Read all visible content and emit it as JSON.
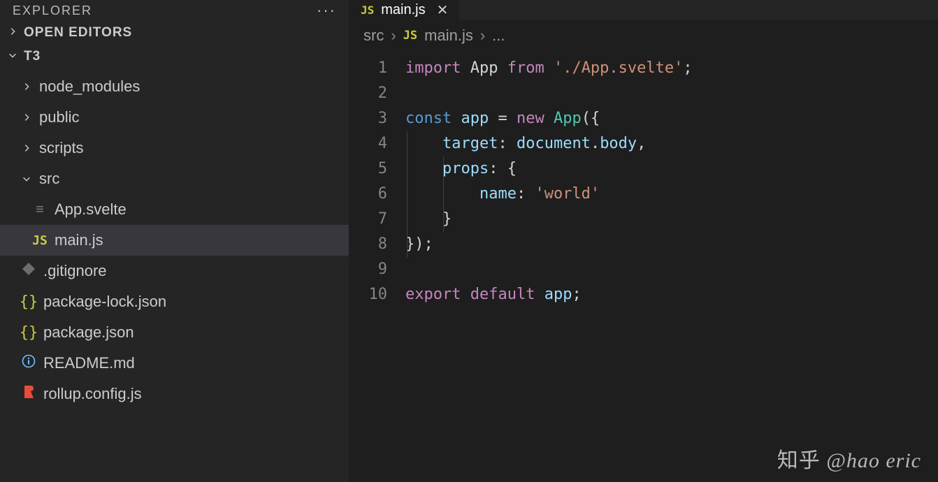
{
  "sidebar": {
    "title": "EXPLORER",
    "sections": {
      "open_editors": {
        "label": "OPEN EDITORS",
        "expanded": false
      },
      "project": {
        "label": "T3",
        "expanded": true,
        "items": [
          {
            "name": "node_modules",
            "kind": "folder",
            "expanded": false,
            "indent": 0
          },
          {
            "name": "public",
            "kind": "folder",
            "expanded": false,
            "indent": 0
          },
          {
            "name": "scripts",
            "kind": "folder",
            "expanded": false,
            "indent": 0
          },
          {
            "name": "src",
            "kind": "folder",
            "expanded": true,
            "indent": 0
          },
          {
            "name": "App.svelte",
            "kind": "file",
            "icon": "svelte",
            "indent": 1
          },
          {
            "name": "main.js",
            "kind": "file",
            "icon": "js",
            "indent": 1,
            "selected": true
          },
          {
            "name": ".gitignore",
            "kind": "file",
            "icon": "git",
            "indent": 0
          },
          {
            "name": "package-lock.json",
            "kind": "file",
            "icon": "json",
            "indent": 0
          },
          {
            "name": "package.json",
            "kind": "file",
            "icon": "json",
            "indent": 0
          },
          {
            "name": "README.md",
            "kind": "file",
            "icon": "info",
            "indent": 0
          },
          {
            "name": "rollup.config.js",
            "kind": "file",
            "icon": "rollup",
            "indent": 0
          }
        ]
      }
    }
  },
  "tabs": [
    {
      "icon": "js",
      "label": "main.js",
      "active": true
    }
  ],
  "breadcrumbs": {
    "parts": [
      "src",
      "main.js"
    ],
    "tail": "..."
  },
  "code": {
    "lines": [
      [
        [
          "kw",
          "import"
        ],
        [
          "",
          ""
        ],
        [
          "",
          "App"
        ],
        [
          "",
          ""
        ],
        [
          "kw",
          "from"
        ],
        [
          "",
          ""
        ],
        [
          "str",
          "'./App.svelte'"
        ],
        [
          "punc",
          ";"
        ]
      ],
      [],
      [
        [
          "const",
          "const"
        ],
        [
          "",
          ""
        ],
        [
          "var",
          "app"
        ],
        [
          "",
          ""
        ],
        [
          "punc",
          "="
        ],
        [
          "",
          ""
        ],
        [
          "kw",
          "new"
        ],
        [
          "",
          ""
        ],
        [
          "type",
          "App"
        ],
        [
          "punc",
          "("
        ],
        [
          "punc",
          "{"
        ]
      ],
      [
        [
          "",
          "    "
        ],
        [
          "prop",
          "target"
        ],
        [
          "punc",
          ":"
        ],
        [
          "",
          ""
        ],
        [
          "var",
          "document"
        ],
        [
          "punc",
          "."
        ],
        [
          "var",
          "body"
        ],
        [
          "punc",
          ","
        ]
      ],
      [
        [
          "",
          "    "
        ],
        [
          "prop",
          "props"
        ],
        [
          "punc",
          ":"
        ],
        [
          "",
          ""
        ],
        [
          "punc",
          "{"
        ]
      ],
      [
        [
          "",
          "        "
        ],
        [
          "prop",
          "name"
        ],
        [
          "punc",
          ":"
        ],
        [
          "",
          ""
        ],
        [
          "str",
          "'world'"
        ]
      ],
      [
        [
          "",
          "    "
        ],
        [
          "punc",
          "}"
        ]
      ],
      [
        [
          "punc",
          "}"
        ],
        [
          "punc",
          ")"
        ],
        [
          "punc",
          ";"
        ]
      ],
      [],
      [
        [
          "kw",
          "export"
        ],
        [
          "",
          ""
        ],
        [
          "kw",
          "default"
        ],
        [
          "",
          ""
        ],
        [
          "var",
          "app"
        ],
        [
          "punc",
          ";"
        ]
      ]
    ]
  },
  "watermark": {
    "zh": "知乎",
    "handle": "@hao eric"
  },
  "icons": {
    "js_label": "JS",
    "json_label": "{}",
    "svelte_glyph": "≡",
    "rollup_glyph": "❘❳"
  }
}
